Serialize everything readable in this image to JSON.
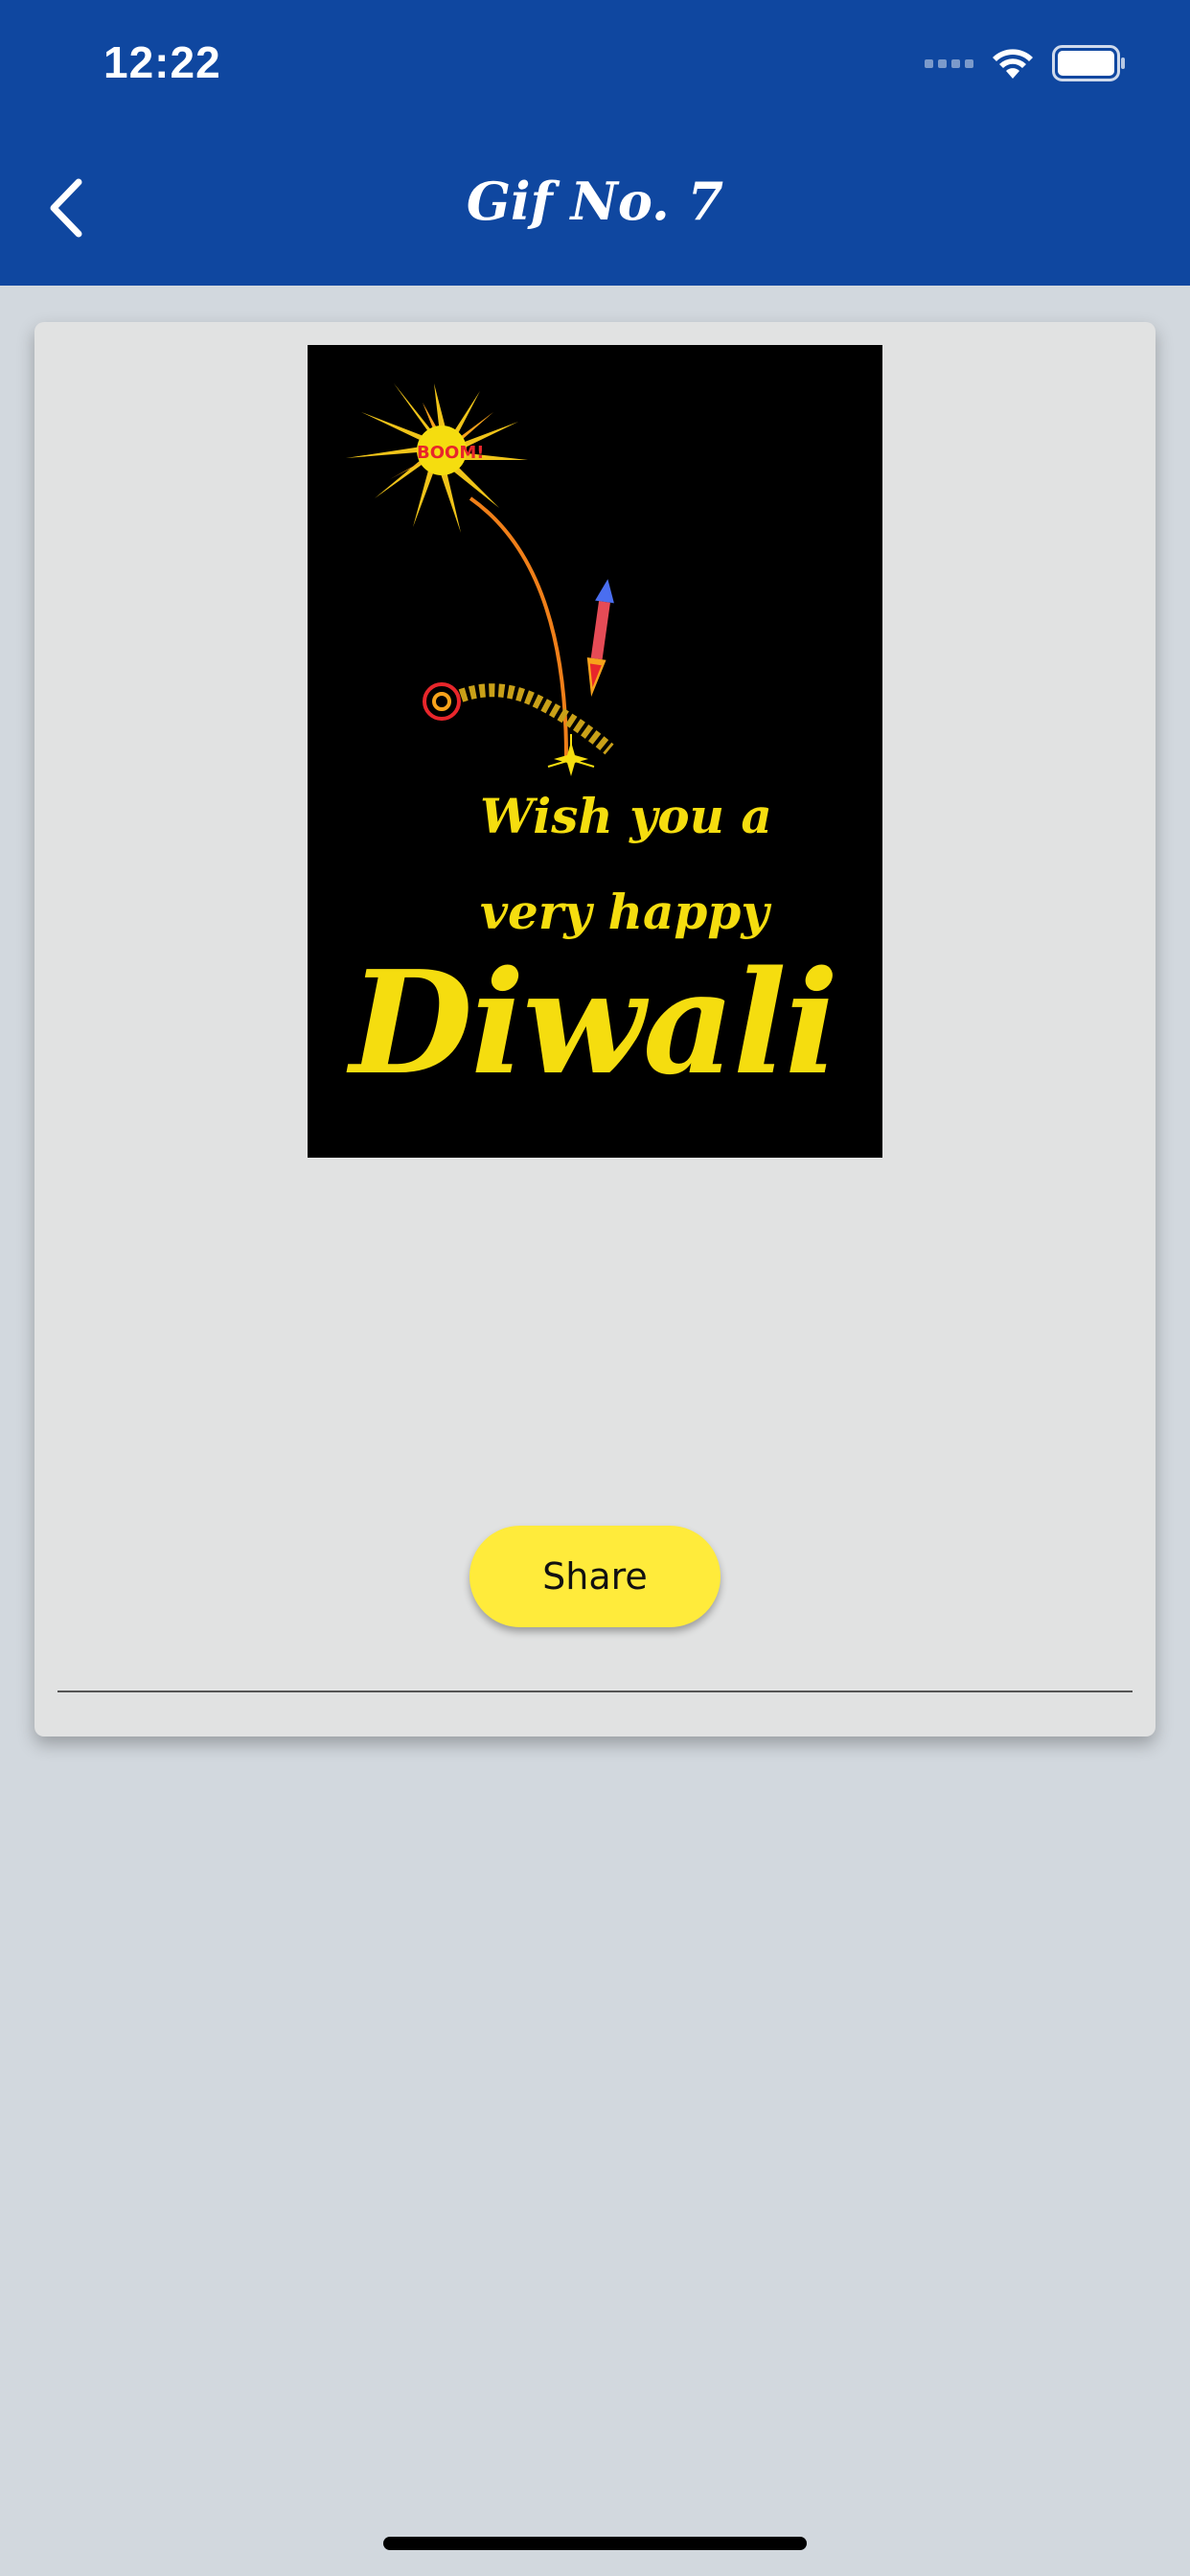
{
  "status_bar": {
    "time": "12:22",
    "signal_icon": "signal-icon",
    "wifi_icon": "wifi-icon",
    "battery_icon": "battery-icon"
  },
  "nav": {
    "back_icon": "chevron-left-icon",
    "title": "Gif No. 7"
  },
  "content": {
    "gif": {
      "text_line1": "Wish you a",
      "text_line2": "very happy",
      "text_line3": "Diwali",
      "burst_text": "BOOM!"
    },
    "share_label": "Share"
  },
  "colors": {
    "header": "#0f47a0",
    "page_background": "#d2d8de",
    "card": "#e1e2e2",
    "share_button": "#ffeb3b",
    "gif_text": "#f5dd0f"
  }
}
